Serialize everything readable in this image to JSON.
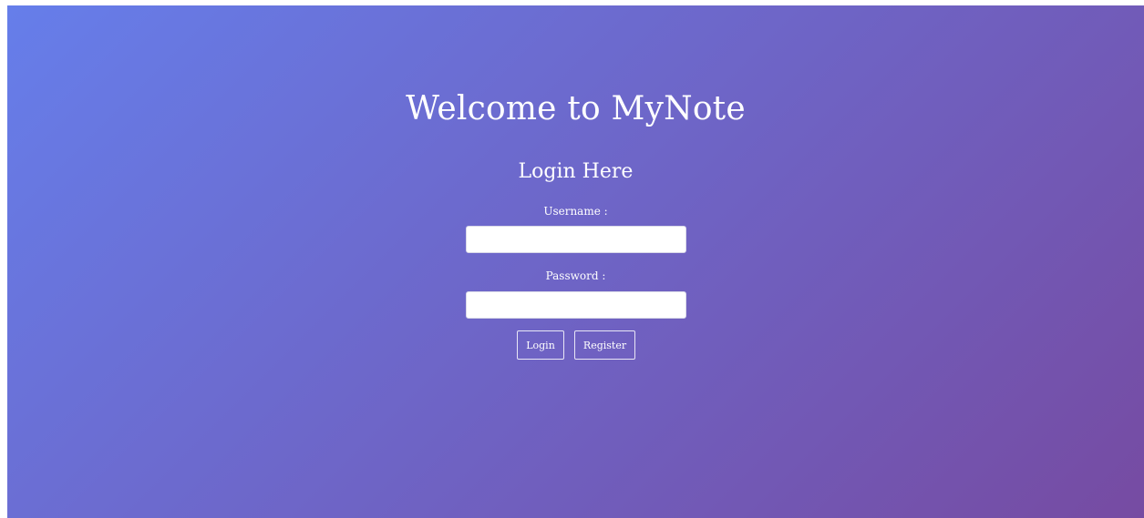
{
  "header": {
    "title": "Welcome to MyNote"
  },
  "login_form": {
    "heading": "Login Here",
    "username_label": "Username :",
    "username_value": "",
    "username_placeholder": "",
    "password_label": "Password :",
    "password_value": "",
    "password_placeholder": "",
    "login_button": "Login",
    "register_button": "Register"
  },
  "colors": {
    "gradient_start": "#667eea",
    "gradient_end": "#764ba2",
    "text": "#ffffff"
  }
}
